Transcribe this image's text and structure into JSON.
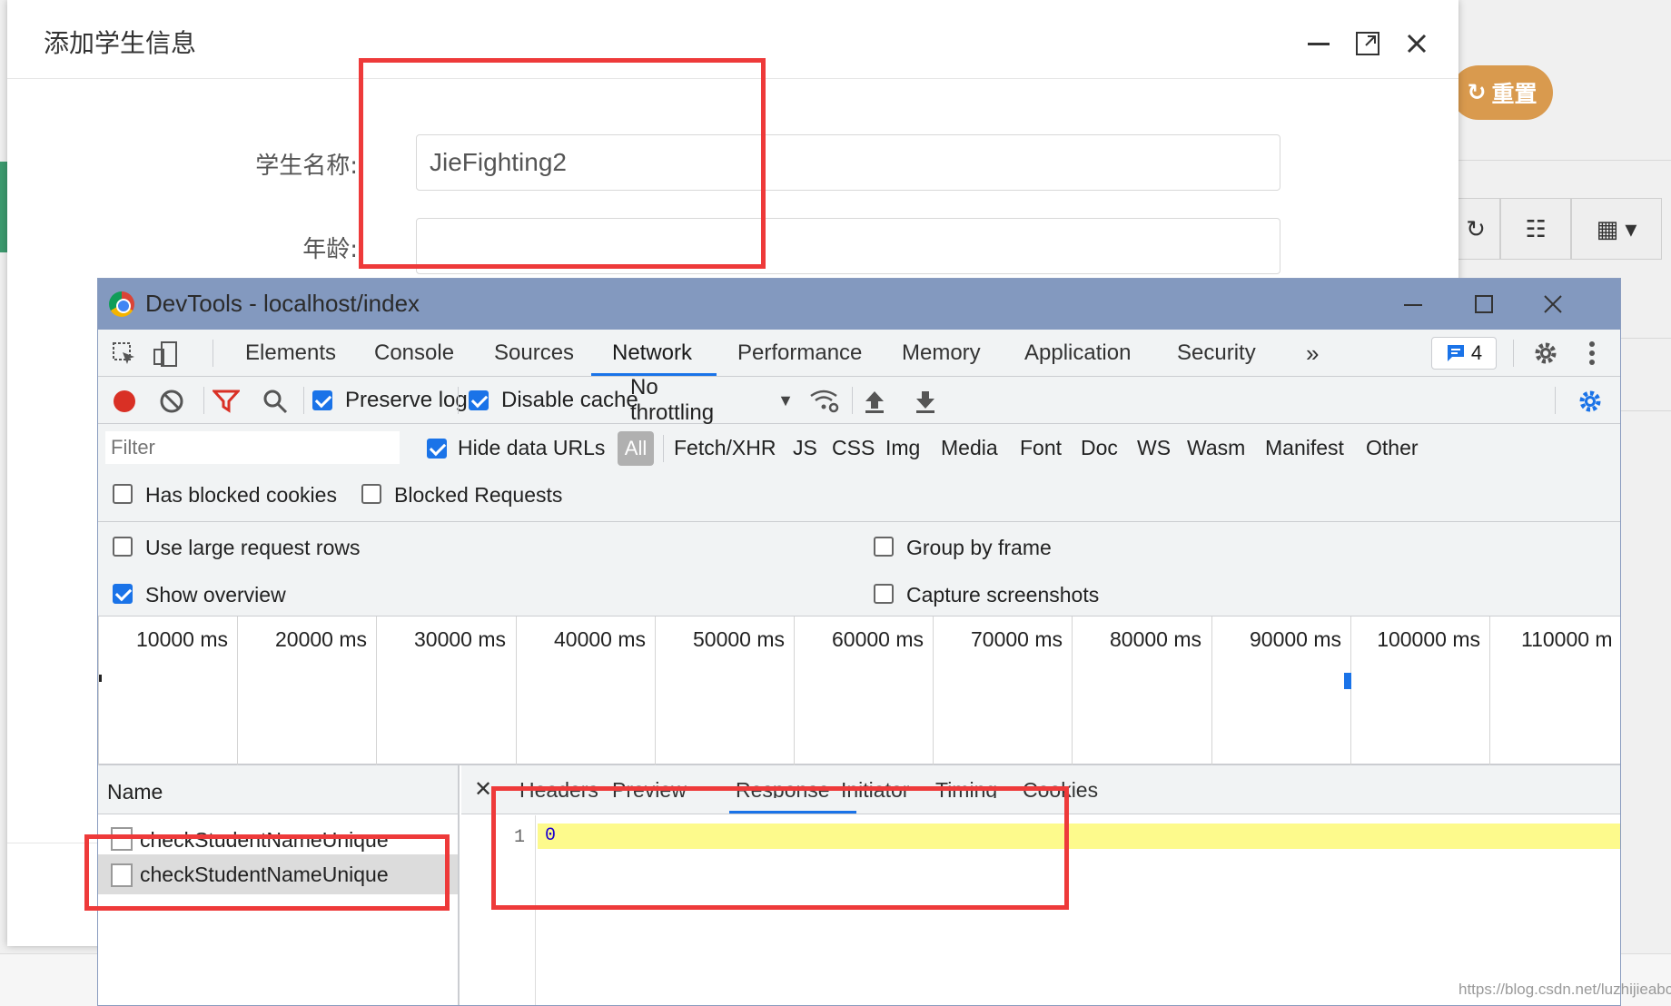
{
  "modal": {
    "title": "添加学生信息",
    "fields": [
      {
        "label": "学生名称:",
        "value": "JieFighting2"
      },
      {
        "label": "年龄:",
        "value": ""
      }
    ]
  },
  "background": {
    "reset_label": "重置"
  },
  "devtools": {
    "window_title": "DevTools - localhost/index",
    "tabs": [
      "Elements",
      "Console",
      "Sources",
      "Network",
      "Performance",
      "Memory",
      "Application",
      "Security"
    ],
    "active_tab": "Network",
    "issues_count": "4",
    "toolbar": {
      "preserve_log": "Preserve log",
      "disable_cache": "Disable cache",
      "throttling": "No throttling"
    },
    "filter": {
      "placeholder": "Filter",
      "hide_data_urls": "Hide data URLs",
      "all": "All",
      "types": [
        "Fetch/XHR",
        "JS",
        "CSS",
        "Img",
        "Media",
        "Font",
        "Doc",
        "WS",
        "Wasm",
        "Manifest",
        "Other"
      ],
      "has_blocked_cookies": "Has blocked cookies",
      "blocked_requests": "Blocked Requests"
    },
    "settings": {
      "large_rows": "Use large request rows",
      "show_overview": "Show overview",
      "group_by_frame": "Group by frame",
      "capture_screenshots": "Capture screenshots"
    },
    "overview_ticks": [
      "10000 ms",
      "20000 ms",
      "30000 ms",
      "40000 ms",
      "50000 ms",
      "60000 ms",
      "70000 ms",
      "80000 ms",
      "90000 ms",
      "100000 ms",
      "110000 m"
    ],
    "name_header": "Name",
    "requests": [
      "checkStudentNameUnique",
      "checkStudentNameUnique"
    ],
    "detail_tabs": [
      "Headers",
      "Preview",
      "Response",
      "Initiator",
      "Timing",
      "Cookies"
    ],
    "active_detail_tab": "Response",
    "response": {
      "line_number": "1",
      "content": "0"
    }
  },
  "watermark": "https://blog.csdn.net/luzhijieabc",
  "colors": {
    "accent": "#1a73e8",
    "highlight_box": "#ee3a3a",
    "response_highlight": "#fdfa8c",
    "titlebar": "#8399bf"
  }
}
